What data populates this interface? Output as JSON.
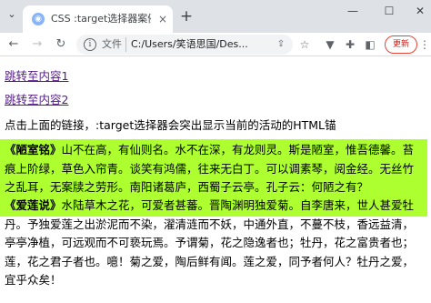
{
  "browser": {
    "tab": {
      "favicon": "globe-icon",
      "title": "CSS :target选择器案例",
      "close": "×"
    },
    "new_tab": "+",
    "window": {
      "minimize": "—",
      "maximize": "☐",
      "close": "✕",
      "menu": "⌄"
    },
    "toolbar": {
      "back": "←",
      "forward": "→",
      "reload": "↻",
      "scheme_label": "文件",
      "url": "C:/Users/笑语思国/Des...",
      "update_label": "更新",
      "more": "⋮"
    }
  },
  "page": {
    "links": [
      {
        "label": "跳转至内容1"
      },
      {
        "label": "跳转至内容2"
      }
    ],
    "tip": "点击上面的链接，:target选择器会突出显示当前的活动的HTML锚",
    "sections": [
      {
        "title": "《陋室铭》",
        "text": "山不在高，有仙则名。水不在深，有龙则灵。斯是陋室，惟吾德馨。苔痕上阶绿，草色入帘青。谈笑有鸿儒，往来无白丁。可以调素琴，阅金经。无丝竹之乱耳，无案牍之劳形。南阳诸葛庐，西蜀子云亭。孔子云：何陋之有？",
        "highlighted": true,
        "highlight_color": "#adff2f"
      },
      {
        "title": "《爱莲说》",
        "text": "水陆草木之花，可爱者甚蕃。晋陶渊明独爱菊。自李唐来，世人甚爱牡丹。予独爱莲之出淤泥而不染，濯清涟而不妖，中通外直，不蔓不枝，香远益清，亭亭净植，可远观而不可亵玩焉。予谓菊，花之隐逸者也；牡丹，花之富贵者也；莲，花之君子者也。噫！菊之爱，陶后鲜有闻。莲之爱，同予者何人？牡丹之爱，宜乎众矣！",
        "highlighted": false
      }
    ]
  },
  "colors": {
    "tabstrip": "#dee1e6",
    "visited_link": "#551a8b",
    "highlight": "#adff2f",
    "update_accent": "#ea4335"
  }
}
